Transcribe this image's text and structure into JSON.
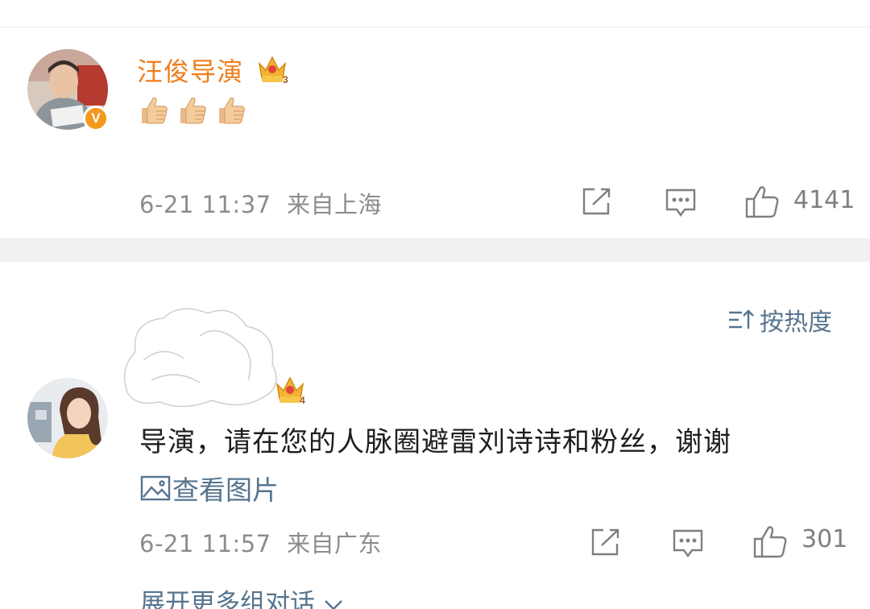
{
  "comments": [
    {
      "username": "汪俊导演",
      "crown_level": "3",
      "verified_badge": "V",
      "content_emoji": [
        "thumbs-up",
        "thumbs-up",
        "thumbs-up"
      ],
      "time": "6-21 11:37",
      "location": "来自上海",
      "likes": "4141"
    },
    {
      "crown_level": "4",
      "content": "导演，请在您的人脉圈避雷刘诗诗和粉丝，谢谢",
      "view_image_label": "查看图片",
      "time": "6-21 11:57",
      "location": "来自广东",
      "likes": "301",
      "expand_label": "展开更多组对话"
    }
  ],
  "sort": {
    "label": "按热度"
  },
  "colors": {
    "username": "#ef7d1c",
    "link": "#56748e",
    "meta": "#8c8c8c",
    "verified": "#f39a1e",
    "separator": "#f1f1f1"
  }
}
